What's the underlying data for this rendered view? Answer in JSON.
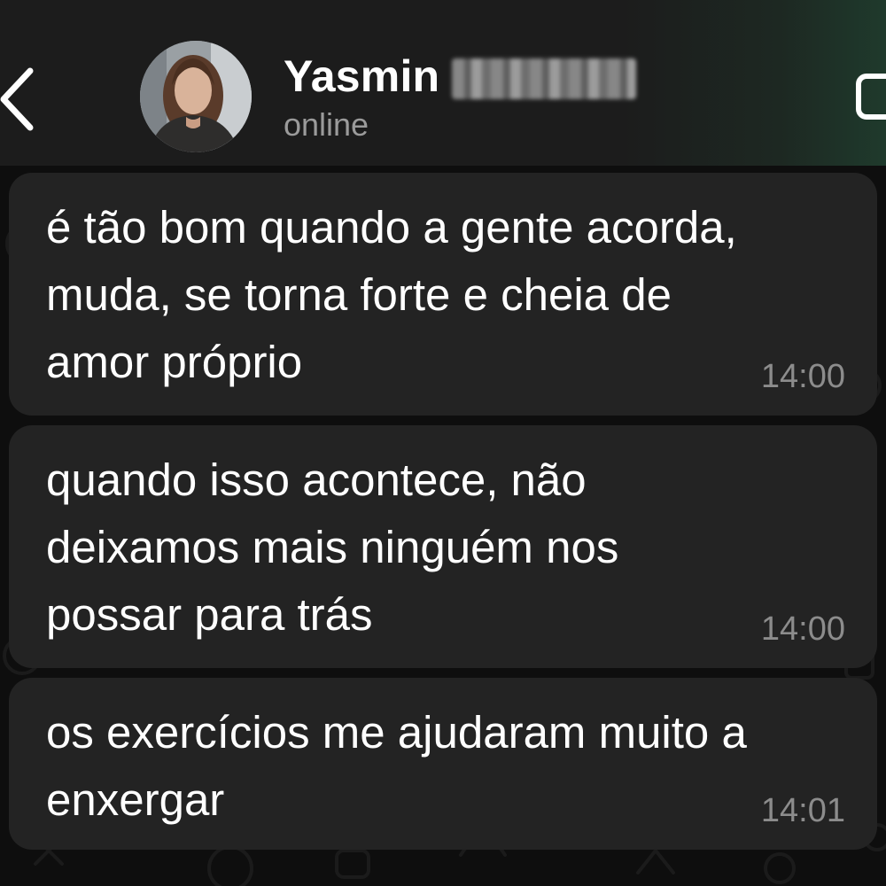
{
  "header": {
    "contact_first_name": "Yasmin",
    "status": "online"
  },
  "messages": [
    {
      "text": "é tão bom quando a gente acorda,\nmuda, se torna forte e cheia de\namor próprio",
      "time": "14:00"
    },
    {
      "text": "quando isso acontece, não\ndeixamos mais ninguém nos\npossar para trás",
      "time": "14:00"
    },
    {
      "text": "os exercícios me ajudaram muito a\nenxergar",
      "time": "14:01"
    }
  ],
  "colors": {
    "header_bg": "#1c1c1c",
    "bubble_bg": "#232323",
    "chat_bg": "#0e0e0e",
    "timestamp": "#8c8c8c",
    "status": "#9b9b9b"
  },
  "icons": {
    "back": "chevron-left-icon",
    "video": "video-camera-icon"
  }
}
